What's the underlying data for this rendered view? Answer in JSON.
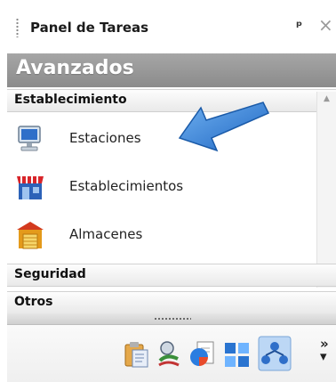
{
  "panel": {
    "title": "Panel de Tareas",
    "pin_icon": "pin-icon",
    "close_icon": "close-icon"
  },
  "banner": {
    "text": "Avanzados"
  },
  "groups": {
    "establecimiento": {
      "label": "Establecimiento",
      "items": [
        {
          "label": "Estaciones",
          "icon": "computer-icon"
        },
        {
          "label": "Establecimientos",
          "icon": "store-icon"
        },
        {
          "label": "Almacenes",
          "icon": "warehouse-icon"
        }
      ]
    },
    "seguridad": {
      "label": "Seguridad"
    },
    "otros": {
      "label": "Otros"
    }
  },
  "toolbar": {
    "icons": [
      "clipboard-icon",
      "tools-icon",
      "chart-document-icon",
      "layout-icon",
      "network-icon"
    ],
    "overflow_icon": "chevron-more-icon"
  },
  "colors": {
    "banner": "#999999",
    "arrow": "#2f7fd6"
  }
}
